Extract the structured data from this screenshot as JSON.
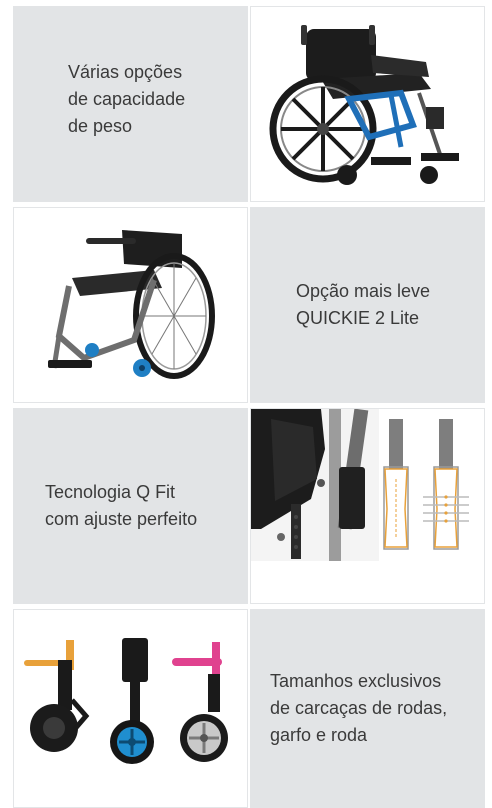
{
  "tiles": [
    {
      "caption": "Várias opções\nde capacidade\nde peso",
      "image_icon": "bariatric-wheelchair-photo"
    },
    {
      "caption": "Opção mais leve\nQUICKIE 2 Lite",
      "image_icon": "lightweight-wheelchair-photo"
    },
    {
      "caption": "Tecnologia Q Fit\ncom ajuste perfeito",
      "image_icon": "qfit-frame-closeup-photo"
    },
    {
      "caption": "Tamanhos exclusivos\nde carcaças de rodas,\ngarfo e roda",
      "image_icon": "caster-fork-wheel-photo"
    }
  ],
  "colors": {
    "tile_bg": "#e2e4e6",
    "text": "#3a3a3a",
    "accent_blue": "#1f7fc4",
    "accent_orange": "#e8a13a",
    "accent_pink": "#e0428f"
  }
}
